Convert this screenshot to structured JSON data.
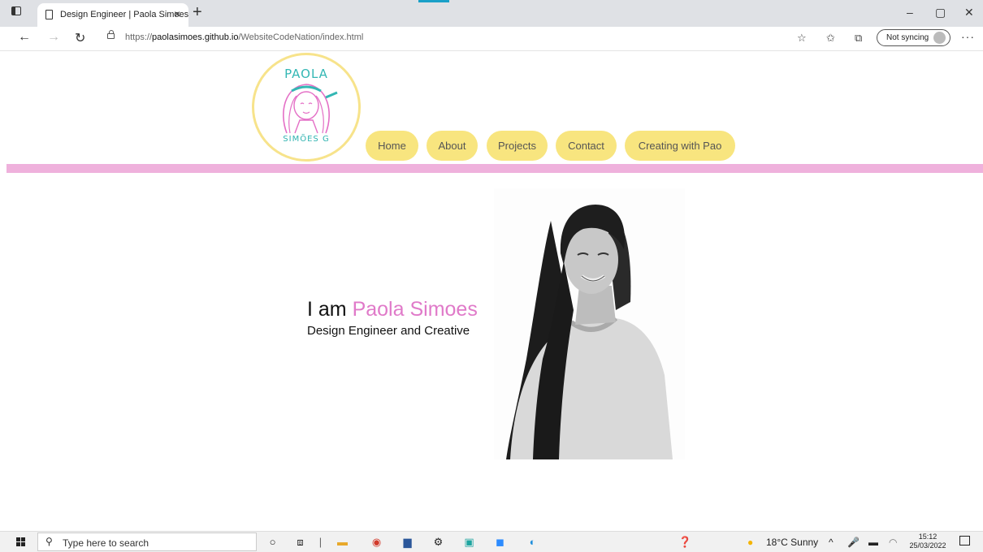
{
  "browser": {
    "tab_title": "Design Engineer | Paola Simoes",
    "tab_close": "×",
    "new_tab": "+",
    "url_prefix": "https://",
    "url_domain": "paolasimoes.github.io",
    "url_path": "/WebsiteCodeNation/index.html",
    "sync_label": "Not syncing",
    "more": "···",
    "minimize": "–",
    "restore": "▢",
    "close": "✕",
    "back": "←",
    "forward": "→",
    "refresh": "↻"
  },
  "logo": {
    "name": "PAOLA",
    "subname": "SIMÕES G"
  },
  "nav": {
    "items": [
      "Home",
      "About",
      "Projects",
      "Contact",
      "Creating with Pao"
    ]
  },
  "hero": {
    "intro": "I am ",
    "name": "Paola Simoes",
    "subtitle": "Design Engineer and Creative"
  },
  "taskbar": {
    "search_placeholder": "Type here to search",
    "weather": "18°C  Sunny",
    "time": "15:12",
    "date": "25/03/2022"
  },
  "colors": {
    "accent_yellow": "#f8e57f",
    "accent_pink": "#efb1dc",
    "name_pink": "#e07ac9",
    "logo_teal": "#33b7b4"
  }
}
